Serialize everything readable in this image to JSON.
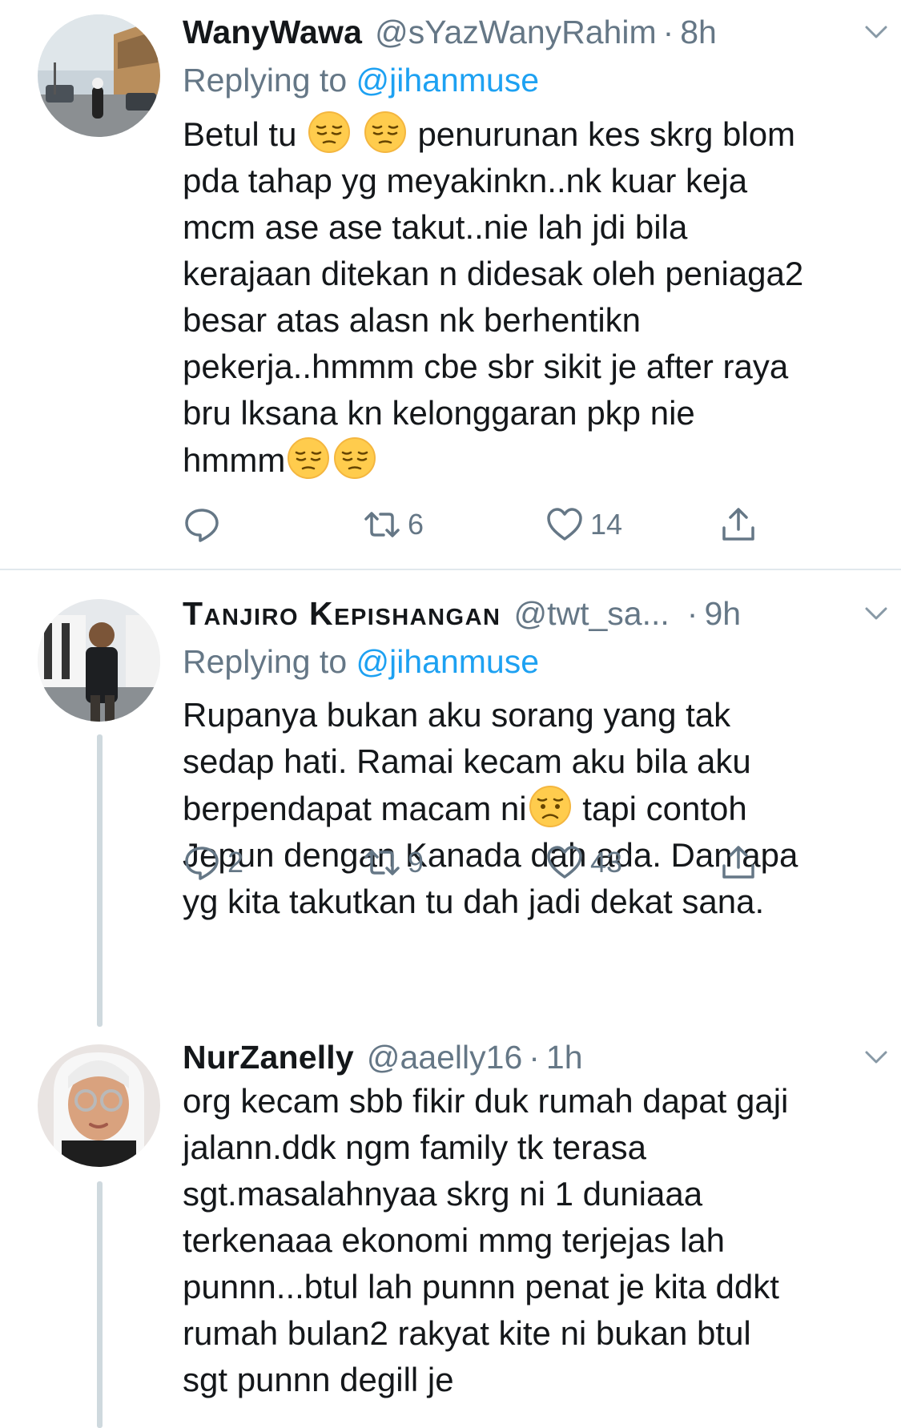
{
  "tweets": [
    {
      "name": "WanyWawa",
      "handle": "@sYazWanyRahim",
      "separator": "·",
      "time": "8h",
      "replying_prefix": "Replying to ",
      "replying_to": "@jihanmuse",
      "body_parts": [
        "Betul tu ",
        " ",
        " penurunan kes skrg blom\npda tahap yg meyakinkn..nk kuar keja\nmcm ase ase takut..nie lah jdi bila\nkerajaan ditekan n didesak oleh peniaga2\nbesar atas alasn nk berhentikn\npekerja..hmmm cbe sbr sikit je after raya\nbru lksana kn kelonggaran pkp nie\nhmmm",
        ""
      ],
      "emoji": "pensive-face",
      "reply_count": "",
      "retweet_count": "6",
      "like_count": "14"
    },
    {
      "name": "Tanjiro Kepishangan",
      "handle": "@twt_sa...",
      "separator": "·",
      "time": "9h",
      "replying_prefix": "Replying to ",
      "replying_to": "@jihanmuse",
      "body_parts": [
        "Rupanya bukan aku sorang yang tak\nsedap hati. Ramai kecam aku bila aku\nberpendapat macam ni",
        " tapi contoh\nJepun dengan Kanada dah ada. Dan apa\nyg kita takutkan tu dah jadi dekat sana."
      ],
      "emoji": "disappointed-face",
      "reply_count": "2",
      "retweet_count": "9",
      "like_count": "43"
    },
    {
      "name": "NurZanelly",
      "handle": "@aaelly16",
      "separator": "·",
      "time": "1h",
      "body": "org kecam sbb fikir duk rumah dapat gaji\njalann.ddk ngm family tk terasa\nsgt.masalahnyaa skrg ni 1 duniaaa\nterkenaaa ekonomi mmg terjejas lah\npunnn...btul lah punnn penat je kita ddkt\nrumah bulan2 rakyat kite ni bukan btul\nsgt punnn degill je"
    }
  ],
  "colors": {
    "text": "#14171a",
    "secondary": "#657786",
    "link": "#1da1f2",
    "divider": "#e1e8ed",
    "thread_line": "#cfd9de"
  }
}
